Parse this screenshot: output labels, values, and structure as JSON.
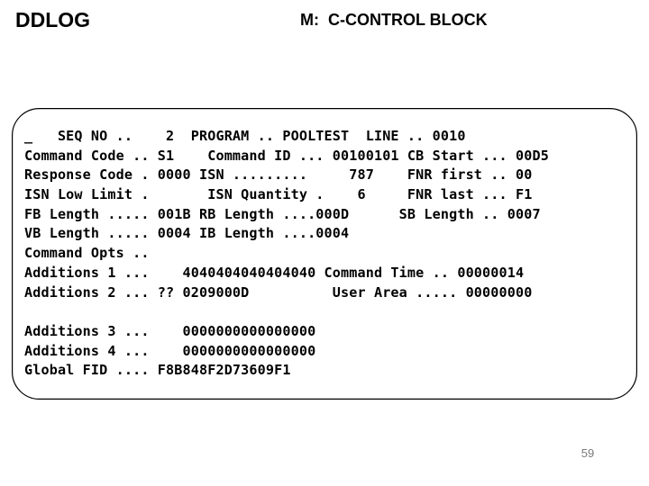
{
  "header": {
    "title": "DDLOG",
    "subtitle": "M:  C-CONTROL BLOCK"
  },
  "frame": {
    "border_color": "#000000",
    "fill_color": "#ffffff",
    "corner_radius_px": 30
  },
  "dump": {
    "lines": [
      "_   SEQ NO ..    2  PROGRAM .. POOLTEST  LINE .. 0010",
      "Command Code .. S1    Command ID ... 00100101 CB Start ... 00D5",
      "Response Code . 0000 ISN .........     787    FNR first .. 00",
      "ISN Low Limit .       ISN Quantity .    6     FNR last ... F1",
      "FB Length ..... 001B RB Length ....000D      SB Length .. 0007",
      "VB Length ..... 0004 IB Length ....0004",
      "Command Opts ..",
      "Additions 1 ...    4040404040404040 Command Time .. 00000014",
      "Additions 2 ... ?? 0209000D          User Area ..... 00000000",
      "",
      "Additions 3 ...    0000000000000000",
      "Additions 4 ...    0000000000000000",
      "Global FID .... F8B848F2D73609F1"
    ],
    "fields": {
      "seq_no": "2",
      "program": "POOLTEST",
      "line": "0010",
      "command_code": "S1",
      "command_id": "00100101",
      "cb_start": "00D5",
      "response_code": "0000",
      "isn": "787",
      "fnr_first": "00",
      "isn_low_limit": "",
      "isn_quantity": "6",
      "fnr_last": "F1",
      "fb_length": "001B",
      "rb_length": "000D",
      "sb_length": "0007",
      "vb_length": "0004",
      "ib_length": "0004",
      "command_opts": "",
      "additions_1": "4040404040404040",
      "command_time": "00000014",
      "additions_2": "?? 0209000D",
      "user_area": "00000000",
      "additions_3": "0000000000000000",
      "additions_4": "0000000000000000",
      "global_fid": "F8B848F2D73609F1"
    }
  },
  "footer": {
    "page_number": "59",
    "page_number_color": "#7a7a7a"
  }
}
